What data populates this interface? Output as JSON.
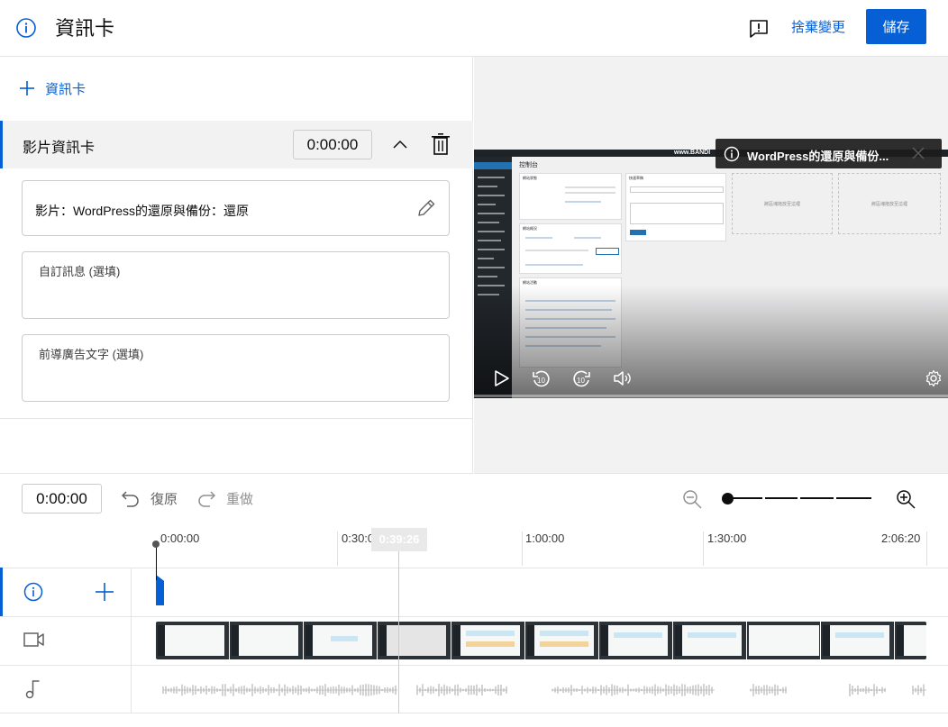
{
  "header": {
    "title": "資訊卡",
    "discard_label": "捨棄變更",
    "save_label": "儲存"
  },
  "editor": {
    "add_card_label": "資訊卡",
    "card": {
      "title": "影片資訊卡",
      "start_time": "0:00:00",
      "video_label": "影片：WordPress的還原與備份：還原",
      "custom_message_label": "自訂訊息 (選填)",
      "teaser_label": "前導廣告文字 (選填)"
    }
  },
  "preview": {
    "overlay_title": "WordPress的還原與備份...",
    "watermark": "www.BANDI",
    "wp": {
      "page_heading": "控制台",
      "widgets": [
        "網站狀態",
        "快速草稿",
        "網站概況",
        "網站活動"
      ],
      "placeholder": "將區塊拖放至這裡"
    }
  },
  "timeline": {
    "current_time": "0:00:00",
    "undo_label": "復原",
    "redo_label": "重做",
    "hover_time": "0:39:26",
    "ruler": [
      "0:00:00",
      "0:30:00",
      "1:00:00",
      "1:30:00",
      "2:06:20"
    ]
  },
  "colors": {
    "accent": "#065fd4",
    "text": "#0d0d0d",
    "border": "#cccccc"
  }
}
